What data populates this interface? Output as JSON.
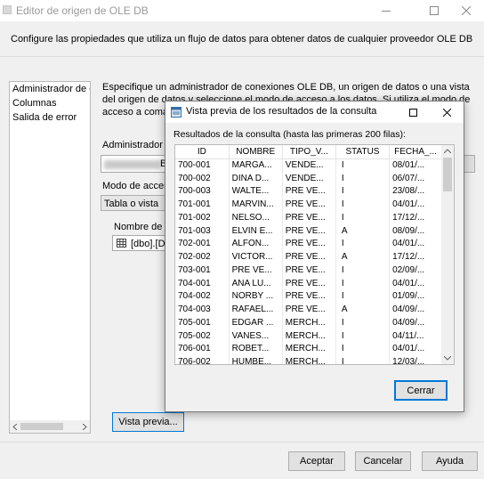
{
  "window": {
    "title": "Editor de origen de OLE DB",
    "description": "Configure las propiedades que utiliza un flujo de datos para obtener datos de cualquier proveedor OLE DB."
  },
  "sidebar": {
    "items": [
      {
        "label": "Administrador de co"
      },
      {
        "label": "Columnas"
      },
      {
        "label": "Salida de error"
      }
    ]
  },
  "main": {
    "intro": "Especifique un administrador de conexiones OLE DB, un origen de datos o una vista del origen de datos y seleccione el modo de acceso a los datos. Si utiliza el modo de acceso a comandos SQL, especifique el co",
    "conn_label": "Administrador d",
    "conn_value": "BI",
    "access_label": "Modo de acceso",
    "access_value": "Tabla o vista",
    "name_label": "Nombre de la",
    "name_value": "[dbo].[D",
    "preview_button": "Vista previa..."
  },
  "footer": {
    "ok": "Aceptar",
    "cancel": "Cancelar",
    "help": "Ayuda"
  },
  "preview": {
    "title": "Vista previa de los resultados de la consulta",
    "caption": "Resultados de la consulta (hasta las primeras 200 filas):",
    "close_button": "Cerrar",
    "columns": [
      "ID",
      "NOMBRE",
      "TIPO_V...",
      "STATUS",
      "FECHA_..."
    ],
    "rows": [
      [
        "700-001",
        "MARGA...",
        "VENDE...",
        "I",
        "08/01/..."
      ],
      [
        "700-002",
        "DINA D...",
        "VENDE...",
        "I",
        "06/07/..."
      ],
      [
        "700-003",
        "WALTE...",
        "PRE VE...",
        "I",
        "23/08/..."
      ],
      [
        "701-001",
        "MARVIN...",
        "PRE VE...",
        "I",
        "04/01/..."
      ],
      [
        "701-002",
        "NELSO...",
        "PRE VE...",
        "I",
        "17/12/..."
      ],
      [
        "701-003",
        "ELVIN E...",
        "PRE VE...",
        "A",
        "08/09/..."
      ],
      [
        "702-001",
        "ALFON...",
        "PRE VE...",
        "I",
        "04/01/..."
      ],
      [
        "702-002",
        "VICTOR...",
        "PRE VE...",
        "A",
        "17/12/..."
      ],
      [
        "703-001",
        "PRE VE...",
        "PRE VE...",
        "I",
        "02/09/..."
      ],
      [
        "704-001",
        "ANA LU...",
        "PRE VE...",
        "I",
        "04/01/..."
      ],
      [
        "704-002",
        "NORBY ...",
        "PRE VE...",
        "I",
        "01/09/..."
      ],
      [
        "704-003",
        "RAFAEL...",
        "PRE VE...",
        "A",
        "04/09/..."
      ],
      [
        "705-001",
        "EDGAR ...",
        "MERCH...",
        "I",
        "04/09/..."
      ],
      [
        "705-002",
        "VANES...",
        "MERCH...",
        "I",
        "04/11/..."
      ],
      [
        "706-001",
        "ROBET...",
        "MERCH...",
        "I",
        "04/01/..."
      ],
      [
        "706-002",
        "HUMBE...",
        "MERCH...",
        "I",
        "12/03/..."
      ]
    ]
  }
}
